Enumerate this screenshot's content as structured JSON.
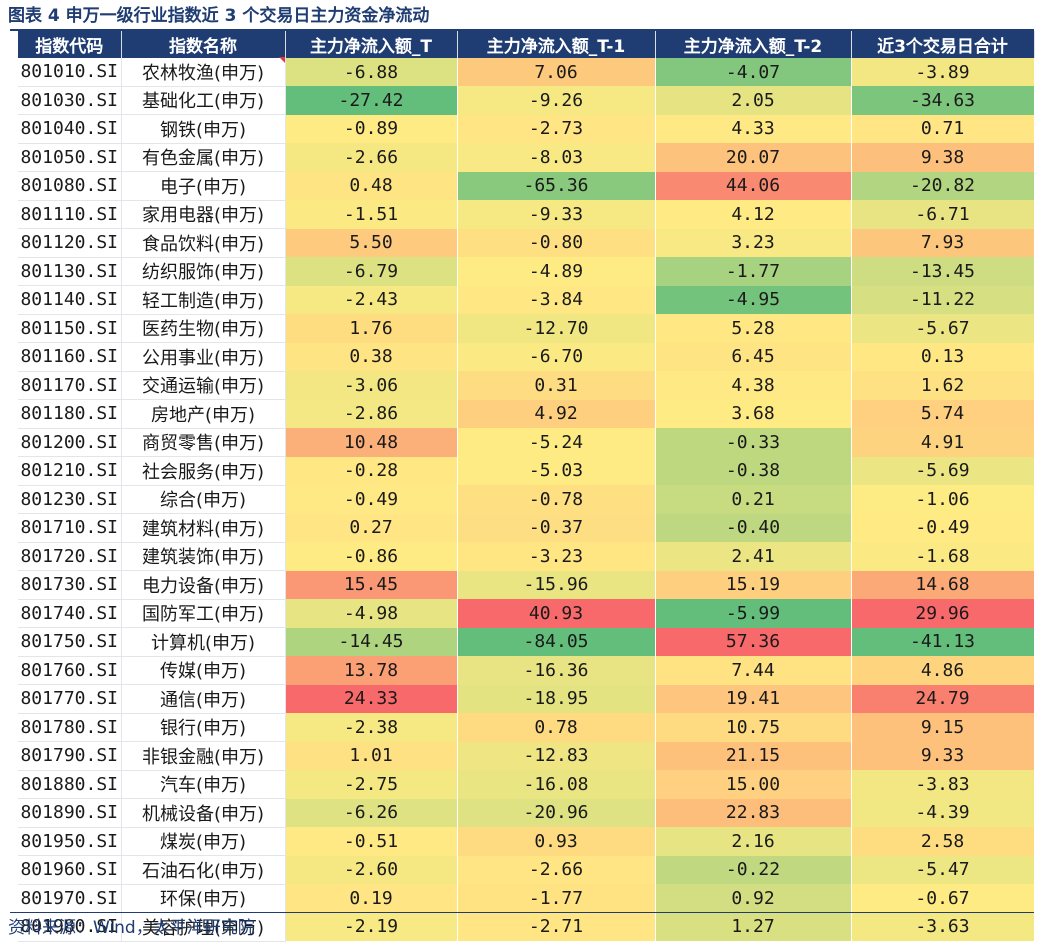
{
  "title": "图表 4  申万一级行业指数近 3 个交易日主力资金净流动",
  "source": "资料来源：Wind，太平洋研究院",
  "headers": [
    "指数代码",
    "指数名称",
    "主力净流入额_T",
    "主力净流入额_T-1",
    "主力净流入额_T-2",
    "近3个交易日合计"
  ],
  "color_scale": {
    "negative": "#63be7b",
    "mid": "#ffeb84",
    "positive": "#f8696b"
  },
  "rows": [
    {
      "code": "801010.SI",
      "name": "农林牧渔(申万)",
      "t": "-6.88",
      "t1": "7.06",
      "t2": "-4.07",
      "sum": "-3.89"
    },
    {
      "code": "801030.SI",
      "name": "基础化工(申万)",
      "t": "-27.42",
      "t1": "-9.26",
      "t2": "2.05",
      "sum": "-34.63"
    },
    {
      "code": "801040.SI",
      "name": "钢铁(申万)",
      "t": "-0.89",
      "t1": "-2.73",
      "t2": "4.33",
      "sum": "0.71"
    },
    {
      "code": "801050.SI",
      "name": "有色金属(申万)",
      "t": "-2.66",
      "t1": "-8.03",
      "t2": "20.07",
      "sum": "9.38"
    },
    {
      "code": "801080.SI",
      "name": "电子(申万)",
      "t": "0.48",
      "t1": "-65.36",
      "t2": "44.06",
      "sum": "-20.82"
    },
    {
      "code": "801110.SI",
      "name": "家用电器(申万)",
      "t": "-1.51",
      "t1": "-9.33",
      "t2": "4.12",
      "sum": "-6.71"
    },
    {
      "code": "801120.SI",
      "name": "食品饮料(申万)",
      "t": "5.50",
      "t1": "-0.80",
      "t2": "3.23",
      "sum": "7.93"
    },
    {
      "code": "801130.SI",
      "name": "纺织服饰(申万)",
      "t": "-6.79",
      "t1": "-4.89",
      "t2": "-1.77",
      "sum": "-13.45"
    },
    {
      "code": "801140.SI",
      "name": "轻工制造(申万)",
      "t": "-2.43",
      "t1": "-3.84",
      "t2": "-4.95",
      "sum": "-11.22"
    },
    {
      "code": "801150.SI",
      "name": "医药生物(申万)",
      "t": "1.76",
      "t1": "-12.70",
      "t2": "5.28",
      "sum": "-5.67"
    },
    {
      "code": "801160.SI",
      "name": "公用事业(申万)",
      "t": "0.38",
      "t1": "-6.70",
      "t2": "6.45",
      "sum": "0.13"
    },
    {
      "code": "801170.SI",
      "name": "交通运输(申万)",
      "t": "-3.06",
      "t1": "0.31",
      "t2": "4.38",
      "sum": "1.62"
    },
    {
      "code": "801180.SI",
      "name": "房地产(申万)",
      "t": "-2.86",
      "t1": "4.92",
      "t2": "3.68",
      "sum": "5.74"
    },
    {
      "code": "801200.SI",
      "name": "商贸零售(申万)",
      "t": "10.48",
      "t1": "-5.24",
      "t2": "-0.33",
      "sum": "4.91"
    },
    {
      "code": "801210.SI",
      "name": "社会服务(申万)",
      "t": "-0.28",
      "t1": "-5.03",
      "t2": "-0.38",
      "sum": "-5.69"
    },
    {
      "code": "801230.SI",
      "name": "综合(申万)",
      "t": "-0.49",
      "t1": "-0.78",
      "t2": "0.21",
      "sum": "-1.06"
    },
    {
      "code": "801710.SI",
      "name": "建筑材料(申万)",
      "t": "0.27",
      "t1": "-0.37",
      "t2": "-0.40",
      "sum": "-0.49"
    },
    {
      "code": "801720.SI",
      "name": "建筑装饰(申万)",
      "t": "-0.86",
      "t1": "-3.23",
      "t2": "2.41",
      "sum": "-1.68"
    },
    {
      "code": "801730.SI",
      "name": "电力设备(申万)",
      "t": "15.45",
      "t1": "-15.96",
      "t2": "15.19",
      "sum": "14.68"
    },
    {
      "code": "801740.SI",
      "name": "国防军工(申万)",
      "t": "-4.98",
      "t1": "40.93",
      "t2": "-5.99",
      "sum": "29.96"
    },
    {
      "code": "801750.SI",
      "name": "计算机(申万)",
      "t": "-14.45",
      "t1": "-84.05",
      "t2": "57.36",
      "sum": "-41.13"
    },
    {
      "code": "801760.SI",
      "name": "传媒(申万)",
      "t": "13.78",
      "t1": "-16.36",
      "t2": "7.44",
      "sum": "4.86"
    },
    {
      "code": "801770.SI",
      "name": "通信(申万)",
      "t": "24.33",
      "t1": "-18.95",
      "t2": "19.41",
      "sum": "24.79"
    },
    {
      "code": "801780.SI",
      "name": "银行(申万)",
      "t": "-2.38",
      "t1": "0.78",
      "t2": "10.75",
      "sum": "9.15"
    },
    {
      "code": "801790.SI",
      "name": "非银金融(申万)",
      "t": "1.01",
      "t1": "-12.83",
      "t2": "21.15",
      "sum": "9.33"
    },
    {
      "code": "801880.SI",
      "name": "汽车(申万)",
      "t": "-2.75",
      "t1": "-16.08",
      "t2": "15.00",
      "sum": "-3.83"
    },
    {
      "code": "801890.SI",
      "name": "机械设备(申万)",
      "t": "-6.26",
      "t1": "-20.96",
      "t2": "22.83",
      "sum": "-4.39"
    },
    {
      "code": "801950.SI",
      "name": "煤炭(申万)",
      "t": "-0.51",
      "t1": "0.93",
      "t2": "2.16",
      "sum": "2.58"
    },
    {
      "code": "801960.SI",
      "name": "石油石化(申万)",
      "t": "-2.60",
      "t1": "-2.66",
      "t2": "-0.22",
      "sum": "-5.47"
    },
    {
      "code": "801970.SI",
      "name": "环保(申万)",
      "t": "0.19",
      "t1": "-1.77",
      "t2": "0.92",
      "sum": "-0.67"
    },
    {
      "code": "801980.SI",
      "name": "美容护理(申万)",
      "t": "-2.19",
      "t1": "-2.71",
      "t2": "1.27",
      "sum": "-3.63"
    }
  ]
}
